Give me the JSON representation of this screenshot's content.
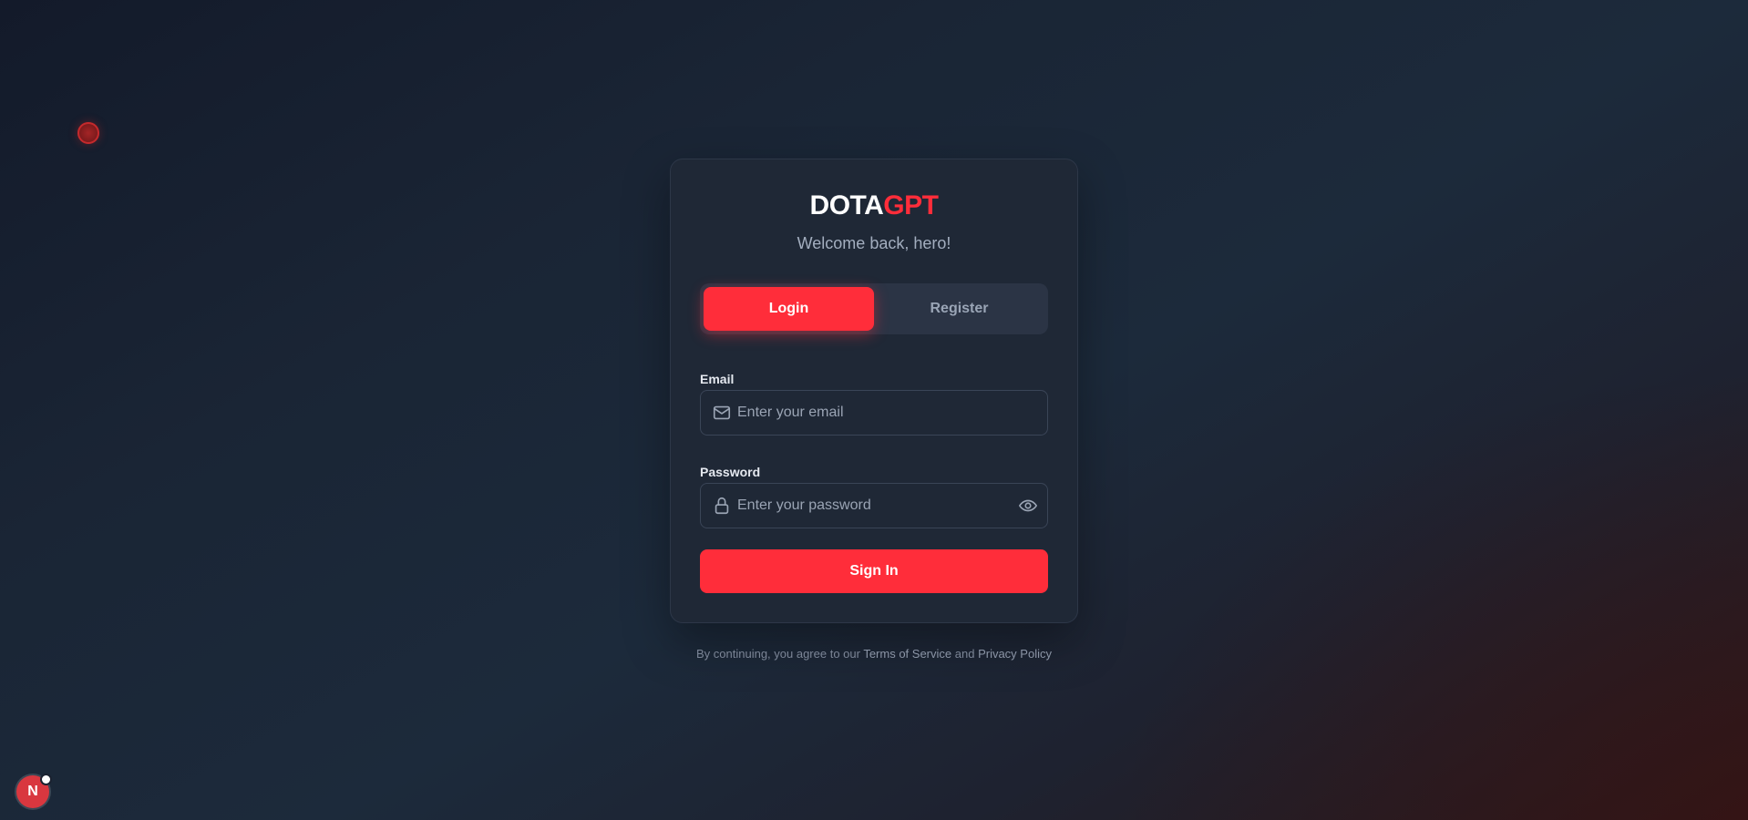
{
  "brand": {
    "part1": "DOTA",
    "part2": "GPT"
  },
  "subtitle": "Welcome back, hero!",
  "tabs": [
    {
      "label": "Login",
      "active": true
    },
    {
      "label": "Register",
      "active": false
    }
  ],
  "form": {
    "email": {
      "label": "Email",
      "placeholder": "Enter your email",
      "value": "",
      "icon": "mail-icon"
    },
    "password": {
      "label": "Password",
      "placeholder": "Enter your password",
      "value": "",
      "icon": "lock-icon",
      "toggle_icon": "eye-icon"
    },
    "submit_label": "Sign In"
  },
  "footer": {
    "prefix": "By continuing, you agree to our ",
    "terms": "Terms of Service",
    "and": " and ",
    "privacy": "Privacy Policy"
  },
  "dev_badge": {
    "letter": "N"
  },
  "colors": {
    "accent": "#ff2d3a",
    "card": "#1f2836",
    "tab_track": "#2b3445"
  }
}
